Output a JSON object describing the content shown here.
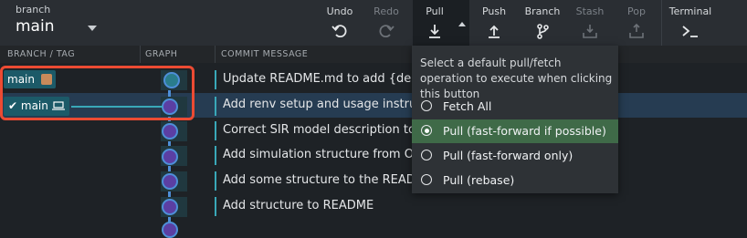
{
  "toolbar": {
    "branch_label": "branch",
    "branch_name": "main",
    "undo": "Undo",
    "redo": "Redo",
    "pull": "Pull",
    "push": "Push",
    "branch": "Branch",
    "stash": "Stash",
    "pop": "Pop",
    "terminal": "Terminal"
  },
  "headers": {
    "branch_tag": "BRANCH / TAG",
    "graph": "GRAPH",
    "commit_message": "COMMIT MESSAGE"
  },
  "tags": {
    "main_remote": "main",
    "main_local": "main"
  },
  "commits": [
    "Update README.md to add {deSolve}",
    "Add renv setup and usage instructions",
    "Correct SIR model description to use",
    "Add simulation structure from Ottar's",
    "Add some structure to the README and",
    "Add structure to README"
  ],
  "dropdown": {
    "description": "Select a default pull/fetch operation to execute when clicking this button",
    "options": [
      "Fetch All",
      "Pull (fast-forward if possible)",
      "Pull (fast-forward only)",
      "Pull (rebase)"
    ],
    "selected_index": 1
  },
  "colors": {
    "accent": "#4e8fd8",
    "selection": "#3f6a48",
    "highlight": "#ec4b33"
  }
}
